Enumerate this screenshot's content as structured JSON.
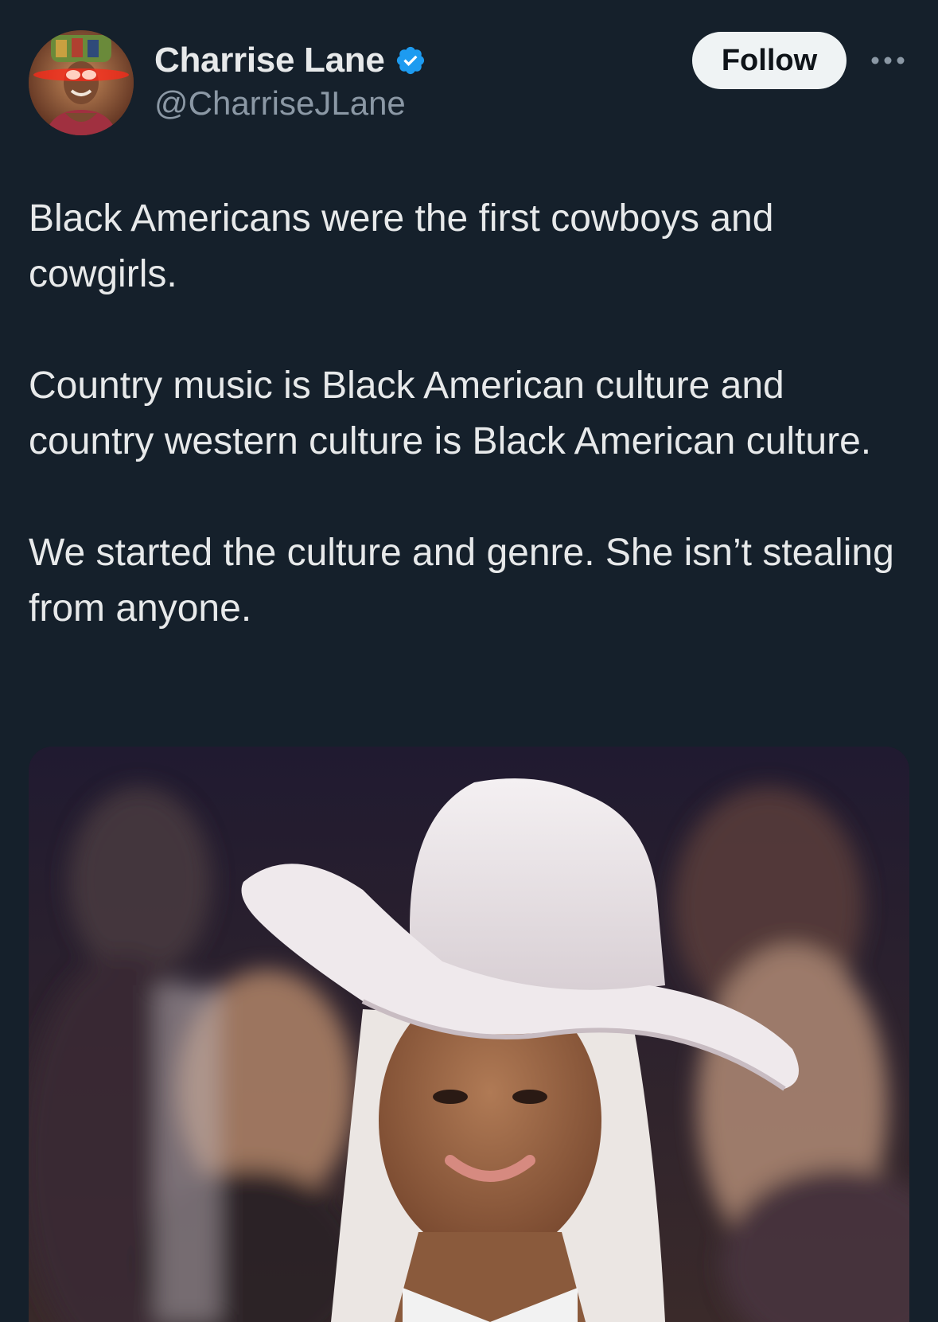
{
  "author": {
    "display_name": "Charrise Lane",
    "handle": "@CharriseJLane",
    "verified": true,
    "avatar_icon": "profile-photo"
  },
  "actions": {
    "follow_label": "Follow",
    "more_icon": "more-horizontal-icon"
  },
  "tweet": {
    "paragraphs": [
      "Black Americans were the first cowboys and cowgirls.",
      "Country music is Black American culture and country western culture is Black American culture.",
      "We started the culture and genre. She isn’t stealing from anyone."
    ]
  },
  "media": {
    "type": "photo"
  },
  "colors": {
    "background": "#15202b",
    "text": "#e7e9ea",
    "secondary_text": "#8b98a5",
    "verified_blue": "#1d9bf0",
    "follow_button_bg": "#eff3f4"
  }
}
